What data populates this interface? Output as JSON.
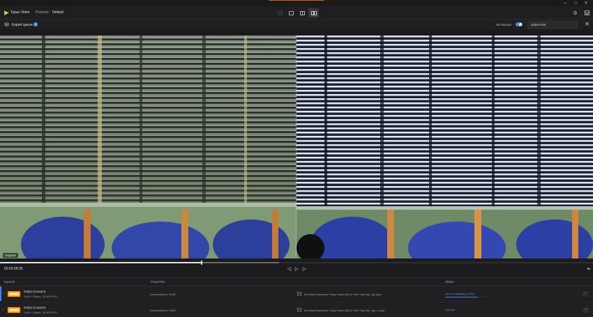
{
  "app": {
    "title": "Topaz Video"
  },
  "breadcrumb": {
    "projects": "Projects",
    "separator": "/",
    "current": "Default"
  },
  "window": {
    "minimize": "─",
    "maximize": "□",
    "close": "✕"
  },
  "view_modes": [
    "single-view-icon",
    "side-by-side-icon",
    "split-view-icon",
    "comparison-view-icon"
  ],
  "export_queue": {
    "title": "Export queue",
    "count": "2",
    "all_sources_label": "All sources",
    "all_sources_on": true,
    "sort": "Oldest first",
    "close": "✕"
  },
  "preview": {
    "original_label": "Original"
  },
  "timeline": {
    "timecode": "00:00:38:08",
    "position": 0.34
  },
  "table": {
    "headers": {
      "exports": "Exports",
      "properties": "Properties",
      "status": "Status"
    },
    "rows": [
      {
        "name": "Only3 (Custom)",
        "spec": "1080 × 960px, 30.000 FPS",
        "properties": "Enhancement, H265",
        "path": "W:/Video/Sunbeam Tuniq Tower (NCIX Tech Tips #1)_alp.mp4",
        "status": "4m1s remaining (1:59x)",
        "progress": 0.78,
        "more": "···"
      },
      {
        "name": "Only3 (Custom)",
        "spec": "1080 × 960px, 30.000 FPS",
        "properties": "Enhancement, H265",
        "path": "W:/Video/Sunbeam Tuniq Tower (NCIX Tech Tips #1)_alp_1.mp4",
        "status": "Queued",
        "progress": 0,
        "more": "···"
      }
    ]
  },
  "colors": {
    "accent": "#3b82f6",
    "brand": "#8bc34a",
    "titlebar_accent": "#c86a1d"
  }
}
